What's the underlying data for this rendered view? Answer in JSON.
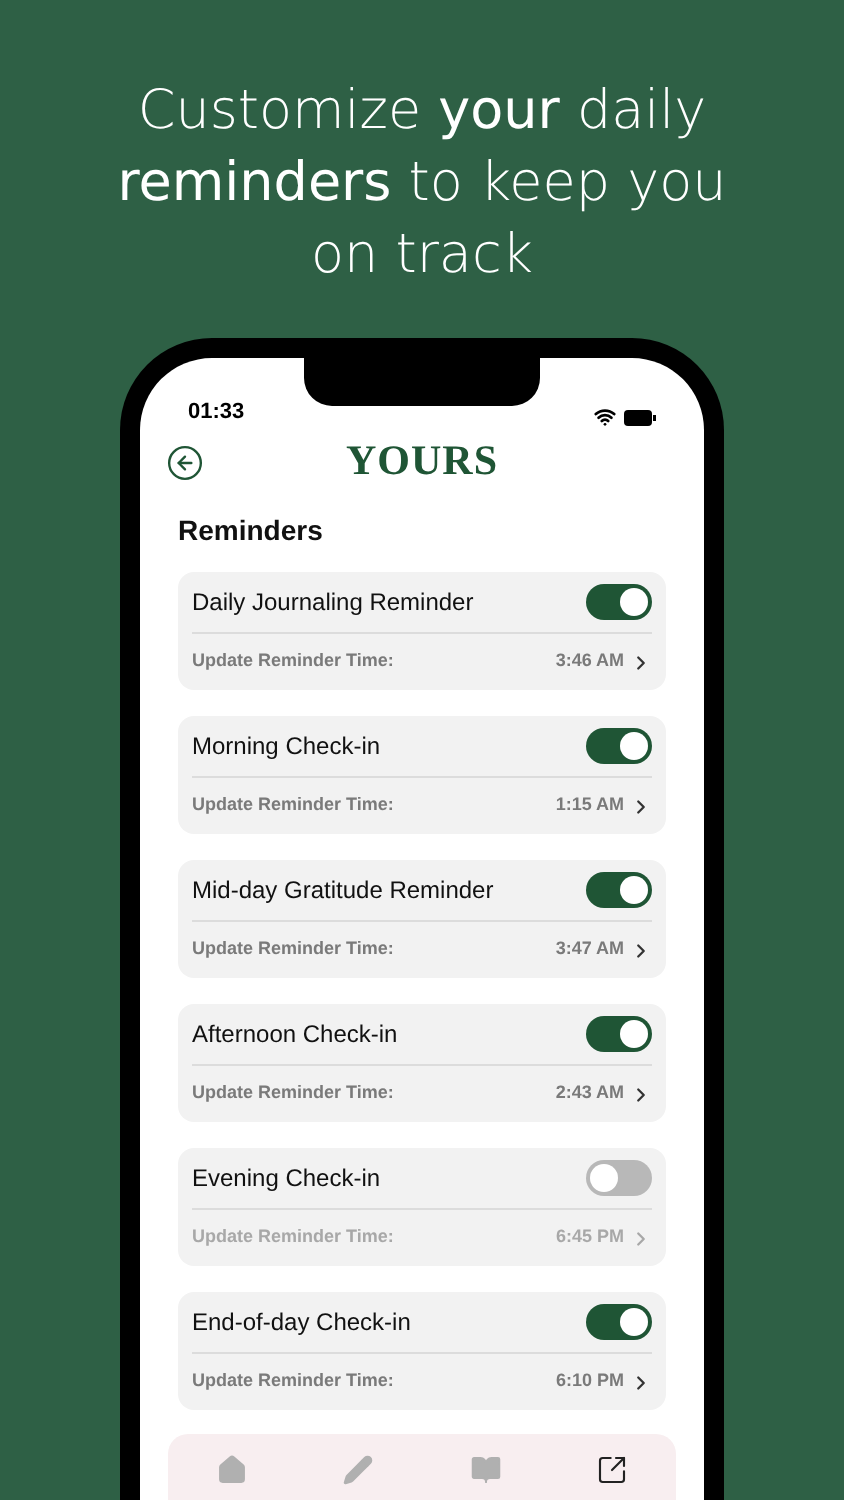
{
  "headline": "Customize **your** daily **reminders** to keep you on track",
  "status_bar": {
    "time": "01:33"
  },
  "header": {
    "logo": "YOURS"
  },
  "section_title": "Reminders",
  "reminders": [
    {
      "title": "Daily Journaling Reminder",
      "on": true,
      "label": "Update Reminder Time:",
      "time": "3:46 AM"
    },
    {
      "title": "Morning Check-in",
      "on": true,
      "label": "Update Reminder Time:",
      "time": "1:15 AM"
    },
    {
      "title": "Mid-day Gratitude Reminder",
      "on": true,
      "label": "Update Reminder Time:",
      "time": "3:47 AM"
    },
    {
      "title": "Afternoon Check-in",
      "on": true,
      "label": "Update Reminder Time:",
      "time": "2:43 AM"
    },
    {
      "title": "Evening Check-in",
      "on": false,
      "label": "Update Reminder Time:",
      "time": "6:45 PM"
    },
    {
      "title": "End-of-day Check-in",
      "on": true,
      "label": "Update Reminder Time:",
      "time": "6:10 PM"
    }
  ],
  "tab_bar": [
    {
      "kind": "home",
      "selected": false
    },
    {
      "kind": "journal",
      "selected": false
    },
    {
      "kind": "library",
      "selected": false
    },
    {
      "kind": "resources",
      "selected": true
    }
  ]
}
